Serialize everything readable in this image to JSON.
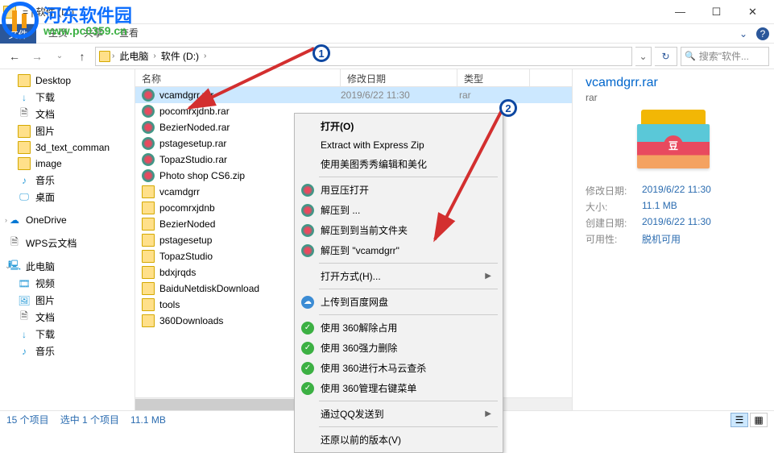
{
  "window": {
    "title": "= | 软件 (D:)",
    "min": "—",
    "max": "☐",
    "close": "✕"
  },
  "ribbon": {
    "file": "文件",
    "tabs": [
      "主页",
      "共享",
      "查看"
    ],
    "help": "?",
    "chev": "⌄"
  },
  "nav": {
    "back": "←",
    "fwd": "→",
    "down": "⌄",
    "up": "↑",
    "refresh": "↻",
    "dropdown": "⌄"
  },
  "breadcrumb": {
    "items": [
      "此电脑",
      "软件 (D:)"
    ],
    "sep": "›"
  },
  "search": {
    "icon": "🔍",
    "placeholder": "搜索\"软件..."
  },
  "sidebar": [
    {
      "icon": "icon-folder",
      "label": "Desktop",
      "indent": 1
    },
    {
      "icon": "icon-download",
      "label": "下载",
      "glyph": "↓",
      "indent": 1
    },
    {
      "icon": "icon-doc",
      "label": "文档",
      "glyph": "🗎",
      "indent": 1
    },
    {
      "icon": "icon-folder",
      "label": "图片",
      "indent": 1
    },
    {
      "icon": "icon-folder",
      "label": "3d_text_comman",
      "indent": 1
    },
    {
      "icon": "icon-folder",
      "label": "image",
      "indent": 1
    },
    {
      "icon": "icon-music",
      "label": "音乐",
      "glyph": "♪",
      "indent": 1
    },
    {
      "icon": "icon-desktop",
      "label": "桌面",
      "glyph": "🖵",
      "indent": 1
    },
    {
      "icon": "icon-onedrive",
      "label": "OneDrive",
      "glyph": "☁",
      "indent": 0,
      "chev": "›"
    },
    {
      "icon": "icon-wps",
      "label": "WPS云文档",
      "glyph": "🗎",
      "indent": 0
    },
    {
      "icon": "icon-pc",
      "label": "此电脑",
      "glyph": "🖳",
      "indent": 0,
      "chev": "⌄",
      "bold": true
    },
    {
      "icon": "icon-video",
      "label": "视频",
      "glyph": "🎞",
      "indent": 1
    },
    {
      "icon": "icon-picture",
      "label": "图片",
      "glyph": "🖼",
      "indent": 1
    },
    {
      "icon": "icon-doc",
      "label": "文档",
      "glyph": "🗎",
      "indent": 1
    },
    {
      "icon": "icon-download",
      "label": "下载",
      "glyph": "↓",
      "indent": 1
    },
    {
      "icon": "icon-music",
      "label": "音乐",
      "glyph": "♪",
      "indent": 1
    }
  ],
  "columns": {
    "name": "名称",
    "date": "修改日期",
    "type": "类型"
  },
  "files": [
    {
      "name": "vcamdgrr.rar",
      "icon": "f-rar",
      "selected": true,
      "date": "2019/6/22 11:30",
      "type": "rar"
    },
    {
      "name": "pocomrxjdnb.rar",
      "icon": "f-rar"
    },
    {
      "name": "BezierNoded.rar",
      "icon": "f-rar"
    },
    {
      "name": "pstagesetup.rar",
      "icon": "f-rar"
    },
    {
      "name": "TopazStudio.rar",
      "icon": "f-rar"
    },
    {
      "name": "Photo shop CS6.zip",
      "icon": "f-zip"
    },
    {
      "name": "vcamdgrr",
      "icon": "icon-folder"
    },
    {
      "name": "pocomrxjdnb",
      "icon": "icon-folder"
    },
    {
      "name": "BezierNoded",
      "icon": "icon-folder"
    },
    {
      "name": "pstagesetup",
      "icon": "icon-folder"
    },
    {
      "name": "TopazStudio",
      "icon": "icon-folder"
    },
    {
      "name": "bdxjrqds",
      "icon": "icon-folder"
    },
    {
      "name": "BaiduNetdiskDownload",
      "icon": "icon-folder"
    },
    {
      "name": "tools",
      "icon": "icon-folder"
    },
    {
      "name": "360Downloads",
      "icon": "icon-folder"
    }
  ],
  "context_menu": [
    {
      "label": "打开(O)",
      "bold": true
    },
    {
      "label": "Extract with Express Zip"
    },
    {
      "label": "使用美图秀秀编辑和美化"
    },
    {
      "sep": true
    },
    {
      "label": "用豆压打开",
      "icon": "cm-douya"
    },
    {
      "label": "解压到 ...",
      "icon": "cm-douya"
    },
    {
      "label": "解压到到当前文件夹",
      "icon": "cm-douya"
    },
    {
      "label": "解压到 \"vcamdgrr\"",
      "icon": "cm-douya"
    },
    {
      "sep": true
    },
    {
      "label": "打开方式(H)...",
      "submenu": true
    },
    {
      "sep": true
    },
    {
      "label": "上传到百度网盘",
      "icon": "cm-baidu",
      "glyph": "☁"
    },
    {
      "sep": true
    },
    {
      "label": "使用 360解除占用",
      "icon": "cm-360",
      "glyph": "✓"
    },
    {
      "label": "使用 360强力删除",
      "icon": "cm-360",
      "glyph": "✓"
    },
    {
      "label": "使用 360进行木马云查杀",
      "icon": "cm-360",
      "glyph": "✓"
    },
    {
      "label": "使用 360管理右键菜单",
      "icon": "cm-360",
      "glyph": "✓"
    },
    {
      "sep": true
    },
    {
      "label": "通过QQ发送到",
      "submenu": true
    },
    {
      "sep": true
    },
    {
      "label": "还原以前的版本(V)"
    }
  ],
  "details": {
    "title": "vcamdgrr.rar",
    "type": "rar",
    "badge": "豆",
    "rows": [
      {
        "lbl": "修改日期:",
        "val": "2019/6/22 11:30"
      },
      {
        "lbl": "大小:",
        "val": "11.1 MB"
      },
      {
        "lbl": "创建日期:",
        "val": "2019/6/22 11:30"
      },
      {
        "lbl": "可用性:",
        "val": "脱机可用"
      }
    ]
  },
  "status": {
    "count": "15 个项目",
    "selected": "选中 1 个项目",
    "size": "11.1 MB"
  },
  "watermark": {
    "text": "河东软件园",
    "url": "www.pc0359.cn"
  },
  "badges": {
    "one": "1",
    "two": "2"
  }
}
